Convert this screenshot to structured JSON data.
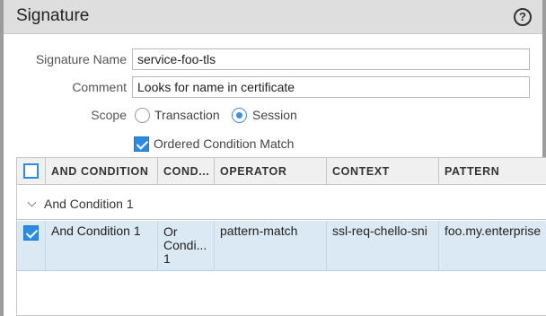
{
  "dialog": {
    "title": "Signature",
    "help_icon": "?"
  },
  "form": {
    "signature_name_label": "Signature Name",
    "signature_name_value": "service-foo-tls",
    "comment_label": "Comment",
    "comment_value": "Looks for name in certificate",
    "scope_label": "Scope",
    "scope_options": [
      "Transaction",
      "Session"
    ],
    "scope_selected": "Session",
    "ordered_condition_label": "Ordered Condition Match",
    "ordered_condition_checked": true
  },
  "grid": {
    "columns": [
      "AND CONDITION",
      "COND...",
      "OPERATOR",
      "CONTEXT",
      "PATTERN"
    ],
    "group_label": "And Condition 1",
    "rows": [
      {
        "checked": true,
        "and_condition": "And Condition 1",
        "cond_lines": [
          "Or",
          "Condi...",
          "1"
        ],
        "operator": "pattern-match",
        "context": "ssl-req-chello-sni",
        "pattern": "foo.my.enterprise"
      }
    ]
  },
  "colors": {
    "accent": "#2c8ae0",
    "selected_row": "#dbe9f5",
    "header_bg": "#dedede"
  }
}
